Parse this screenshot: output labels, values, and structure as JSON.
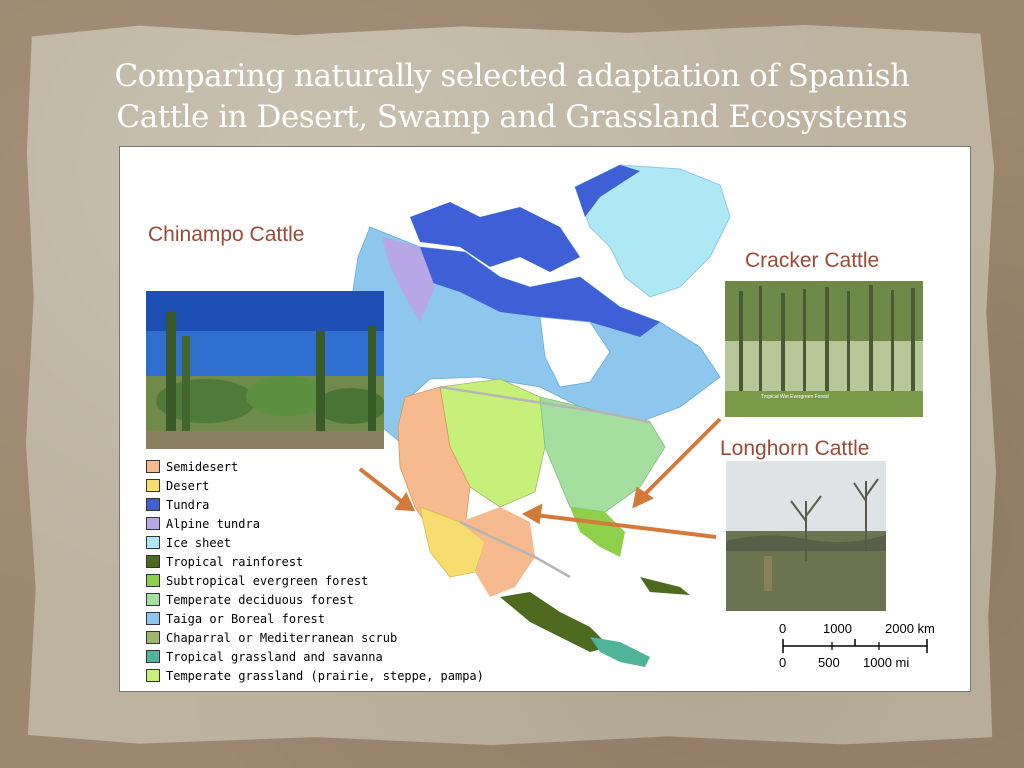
{
  "slide": {
    "title_line1": "Comparing  naturally  selected  adaptation  of  Spanish",
    "title_line2": "Cattle  in  Desert,  Swamp  and  Grassland Ecosystems"
  },
  "cattle": {
    "chinampo_label": "Chinampo Cattle",
    "cracker_label": "Cracker Cattle",
    "longhorn_label": "Longhorn Cattle",
    "cracker_photo_caption": "Tropical Wet Evergreen Forest"
  },
  "legend": [
    {
      "label": "Semidesert",
      "color": "#f7b98e"
    },
    {
      "label": "Desert",
      "color": "#f7dc6f"
    },
    {
      "label": "Tundra",
      "color": "#3f5fd6"
    },
    {
      "label": "Alpine tundra",
      "color": "#b7a7e6"
    },
    {
      "label": "Ice sheet",
      "color": "#aee8f4"
    },
    {
      "label": "Tropical rainforest",
      "color": "#4e6a1f"
    },
    {
      "label": "Subtropical evergreen forest",
      "color": "#8fd04a"
    },
    {
      "label": "Temperate deciduous forest",
      "color": "#a5dfa0"
    },
    {
      "label": "Taiga or Boreal forest",
      "color": "#8ec7ee"
    },
    {
      "label": "Chaparral or Mediterranean scrub",
      "color": "#9fb76a"
    },
    {
      "label": "Tropical grassland and savanna",
      "color": "#4fb49a"
    },
    {
      "label": "Temperate grassland (prairie, steppe, pampa)",
      "color": "#c7f07a"
    }
  ],
  "scale": {
    "km_0": "0",
    "km_1000": "1000",
    "km_2000": "2000 km",
    "mi_0": "0",
    "mi_500": "500",
    "mi_1000": "1000 mi"
  },
  "colors": {
    "arrow": "#d27a3a",
    "label_text": "#9a4a36",
    "water": "#ffffff",
    "boundary": "#b5b5b5"
  }
}
